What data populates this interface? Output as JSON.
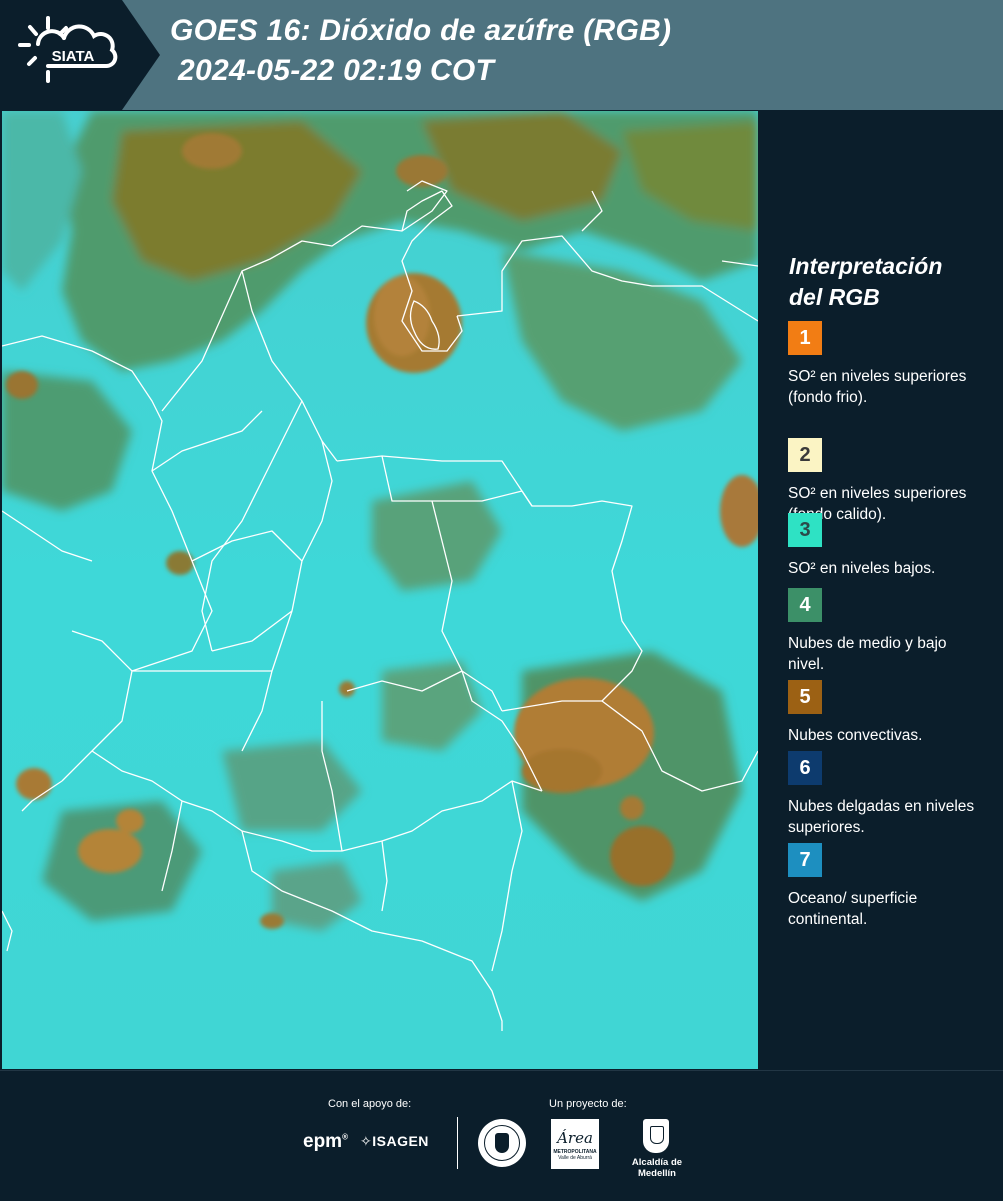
{
  "header": {
    "logo_text": "SIATA",
    "title_line1": "GOES 16: Dióxido de azúfre (RGB)",
    "title_line2": "2024-05-22 02:19 COT"
  },
  "legend": {
    "title_line1": "Interpretación",
    "title_line2": "del RGB",
    "items": [
      {
        "number": "1",
        "color": "#f27d14",
        "text_color": "#ffffff",
        "label": "SO² en niveles superiores (fondo frio)."
      },
      {
        "number": "2",
        "color": "#fbf4c4",
        "text_color": "#3a3a3a",
        "label": "SO² en niveles superiores (fondo calido)."
      },
      {
        "number": "3",
        "color": "#2ee2c4",
        "text_color": "#2b4a4a",
        "label": "SO² en niveles bajos."
      },
      {
        "number": "4",
        "color": "#3c9068",
        "text_color": "#ffffff",
        "label": "Nubes de medio y bajo nivel."
      },
      {
        "number": "5",
        "color": "#9c6114",
        "text_color": "#ffffff",
        "label": "Nubes convectivas."
      },
      {
        "number": "6",
        "color": "#0d3b6e",
        "text_color": "#ffffff",
        "label": "Nubes delgadas en niveles superiores."
      },
      {
        "number": "7",
        "color": "#1d8fc0",
        "text_color": "#ffffff",
        "label": "Oceano/ superficie continental."
      }
    ]
  },
  "footer": {
    "support_label": "Con el apoyo de:",
    "project_label": "Un proyecto de:",
    "epm": "epm",
    "isagen": "ISAGEN",
    "area_word": "Área",
    "area_sub1": "METROPOLITANA",
    "area_sub2": "Valle de Aburrá",
    "alcaldia": "Alcaldía de Medellín"
  },
  "colors": {
    "header_bg": "#4e7380",
    "panel_bg": "#0b1e2b",
    "map_cyan": "#3fd6d6",
    "cloud_green": "#4a9a70",
    "cloud_olive": "#7f7a2a",
    "convective_brown": "#a3742c"
  }
}
